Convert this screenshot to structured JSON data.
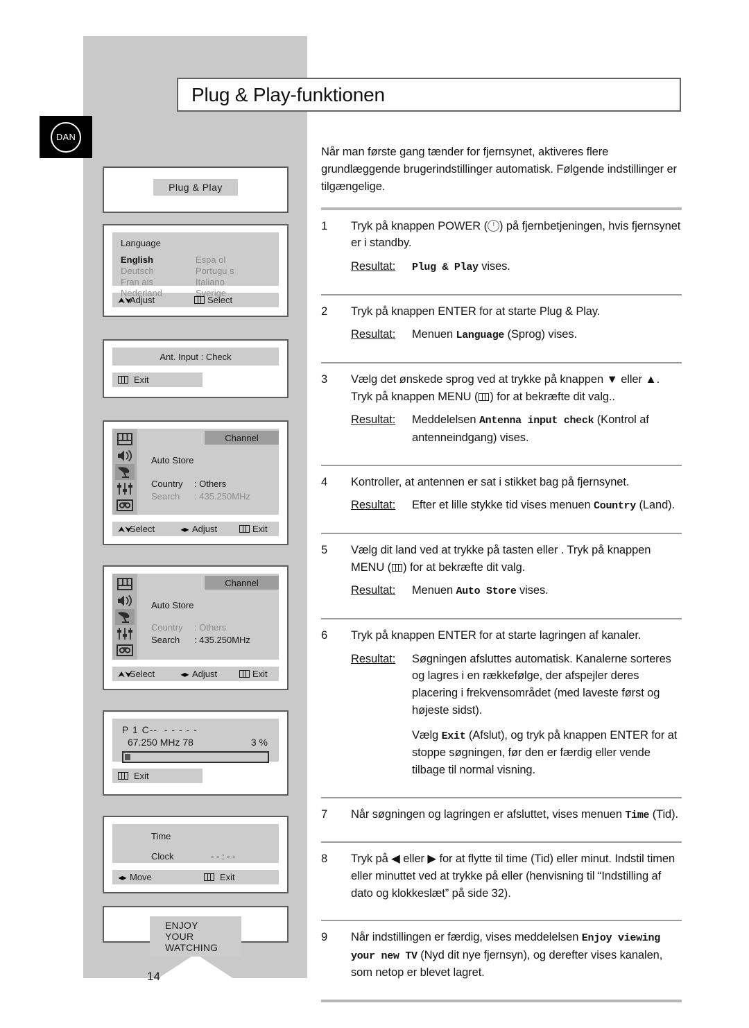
{
  "page": {
    "title": "Plug & Play-funktionen",
    "number": "14",
    "language_badge": "DAN"
  },
  "intro": "Når man første gang tænder for fjernsynet, aktiveres flere grundlæggende brugerindstillinger automatisk. Følgende indstillinger er tilgængelige.",
  "labels": {
    "result": "Resultat:"
  },
  "steps": [
    {
      "num": "1",
      "text_a": "Tryk på knappen POWER (",
      "text_b": ") på fjernbetjeningen, hvis fjernsynet er i standby.",
      "result_pre": "",
      "result_mono": "Plug & Play",
      "result_post": " vises."
    },
    {
      "num": "2",
      "text_a": "Tryk på knappen ENTER for at starte Plug & Play.",
      "result_pre": "Menuen ",
      "result_mono": "Language",
      "result_post": " (Sprog) vises."
    },
    {
      "num": "3",
      "text_a": "Vælg det ønskede sprog ved at trykke på knappen ▼ eller ▲. Tryk på knappen MENU (",
      "text_b": ") for at bekræfte dit valg..",
      "result_pre": "Meddelelsen ",
      "result_mono": "Antenna input check",
      "result_post": " (Kontrol af antenneindgang) vises."
    },
    {
      "num": "4",
      "text_a": "Kontroller, at antennen er sat i stikket bag på fjernsynet.",
      "result_pre": "Efter et lille stykke tid vises menuen ",
      "result_mono": "Country",
      "result_post": " (Land)."
    },
    {
      "num": "5",
      "text_a": "Vælg dit land ved at trykke på tasten      eller     . Tryk på knappen MENU (",
      "text_b": ") for at bekræfte dit valg.",
      "result_pre": "Menuen ",
      "result_mono": "Auto Store",
      "result_post": " vises."
    },
    {
      "num": "6",
      "text_a": "Tryk på knappen ENTER for at starte lagringen af kanaler.",
      "result_pre": "Søgningen afsluttes automatisk. Kanalerne sorteres og lagres i en rækkefølge, der afspejler deres placering i frekvensområdet (med laveste først og højeste sidst).",
      "result_mono": "",
      "result_post": "",
      "extra_pre": "Vælg ",
      "extra_mono": "Exit",
      "extra_post": " (Afslut), og tryk på knappen ENTER for at stoppe søgningen, før den er færdig eller vende tilbage til normal visning."
    },
    {
      "num": "7",
      "text_a": "Når søgningen og lagringen er afsluttet, vises menuen ",
      "inline_mono": "Time",
      "text_b": " (Tid)."
    },
    {
      "num": "8",
      "text_a": "Tryk på ◀ eller ▶ for at flytte til time (Tid) eller minut. Indstil timen eller minuttet ved at trykke på      eller      (henvisning til “Indstilling af dato og klokkeslæt” på side 32)."
    },
    {
      "num": "9",
      "text_a": "Når indstillingen er færdig, vises meddelelsen ",
      "inline_mono": "Enjoy viewing your new TV",
      "text_b": " (Nyd dit nye fjernsyn), og derefter vises kanalen, som netop er blevet lagret."
    }
  ],
  "osd": {
    "plug_play": {
      "chip": "Plug  &  Play"
    },
    "language": {
      "title": "Language",
      "col_left": [
        "English",
        "Deutsch",
        "Fran ais",
        "Nederland"
      ],
      "col_right": [
        "Espa ol",
        "Portugu s",
        "Italiano",
        "Sverige"
      ],
      "selected": "English",
      "footer": {
        "adjust": "Adjust",
        "select": "Select"
      }
    },
    "ant_input": {
      "screen": "Ant. Input : Check",
      "footer": {
        "exit": "Exit"
      }
    },
    "channel_1": {
      "tag": "Channel",
      "auto_store": "Auto Store",
      "country_label": "Country",
      "country_value": ": Others",
      "search_label": "Search",
      "search_value": ": 435.250MHz",
      "active_row": "Country",
      "footer": {
        "select": "Select",
        "adjust": "Adjust",
        "exit": "Exit"
      },
      "icons": [
        "picture-icon",
        "sound-icon",
        "channel-icon",
        "setup-icon",
        "vcr-icon"
      ],
      "active_icon": "channel-icon"
    },
    "channel_2": {
      "tag": "Channel",
      "auto_store": "Auto Store",
      "country_label": "Country",
      "country_value": ": Others",
      "search_label": "Search",
      "search_value": ": 435.250MHz",
      "active_row": "Search",
      "footer": {
        "select": "Select",
        "adjust": "Adjust",
        "exit": "Exit"
      },
      "icons": [
        "picture-icon",
        "sound-icon",
        "channel-icon",
        "setup-icon",
        "vcr-icon"
      ],
      "active_icon": "channel-icon"
    },
    "progress": {
      "line1": "P 1 C--  - - - - -",
      "freq": "67.250 MHz  78",
      "percent": "3 %",
      "percent_value": 3,
      "footer": {
        "exit": "Exit"
      }
    },
    "time": {
      "title": "Time",
      "clock_label": "Clock",
      "clock_value": "- - :  - -",
      "footer": {
        "move": "Move",
        "exit": "Exit"
      }
    },
    "enjoy": {
      "chip": "ENJOY YOUR WATCHING"
    }
  },
  "colors": {
    "sidebar": "#c9c9c9",
    "osd_screen": "#cccccc",
    "osd_border": "#5d5d5d",
    "rule": "#b6b6b6",
    "dim_text": "#8c8c8c"
  }
}
